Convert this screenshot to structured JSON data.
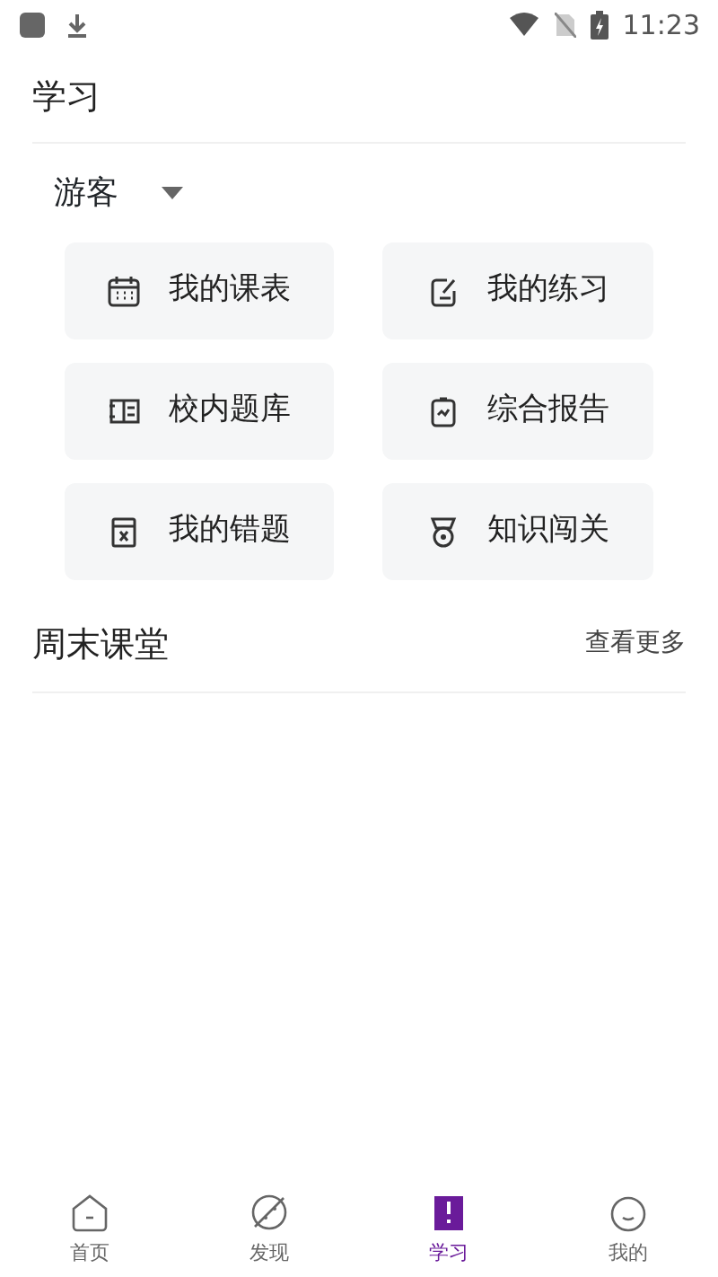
{
  "status_bar": {
    "time": "11:23"
  },
  "header": {
    "title": "学习"
  },
  "role_selector": {
    "value": "游客"
  },
  "tiles": [
    {
      "label": "我的课表"
    },
    {
      "label": "我的练习"
    },
    {
      "label": "校内题库"
    },
    {
      "label": "综合报告"
    },
    {
      "label": "我的错题"
    },
    {
      "label": "知识闯关"
    }
  ],
  "section": {
    "title": "周末课堂",
    "more": "查看更多"
  },
  "tabs": [
    {
      "label": "首页",
      "selected": false
    },
    {
      "label": "发现",
      "selected": false
    },
    {
      "label": "学习",
      "selected": true
    },
    {
      "label": "我的",
      "selected": false
    }
  ]
}
